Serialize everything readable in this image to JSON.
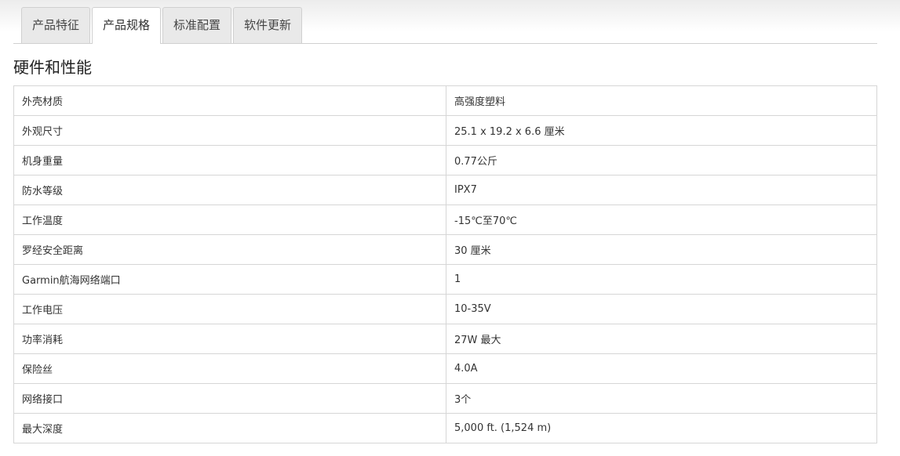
{
  "tabs": [
    {
      "label": "产品特征",
      "active": false
    },
    {
      "label": "产品规格",
      "active": true
    },
    {
      "label": "标准配置",
      "active": false
    },
    {
      "label": "软件更新",
      "active": false
    }
  ],
  "section": {
    "title": "硬件和性能"
  },
  "specs": [
    {
      "label": "外壳材质",
      "value": "高强度塑料"
    },
    {
      "label": "外观尺寸",
      "value": "25.1 x 19.2 x 6.6 厘米"
    },
    {
      "label": "机身重量",
      "value": "0.77公斤"
    },
    {
      "label": "防水等级",
      "value": "IPX7"
    },
    {
      "label": "工作温度",
      "value": "-15℃至70℃"
    },
    {
      "label": "罗经安全距离",
      "value": "30 厘米"
    },
    {
      "label": "Garmin航海网络端口",
      "value": "1"
    },
    {
      "label": "工作电压",
      "value": "10-35V"
    },
    {
      "label": "功率消耗",
      "value": "27W 最大"
    },
    {
      "label": "保险丝",
      "value": "4.0A"
    },
    {
      "label": "网络接口",
      "value": "3个"
    },
    {
      "label": "最大深度",
      "value": "5,000 ft. (1,524 m)"
    }
  ]
}
